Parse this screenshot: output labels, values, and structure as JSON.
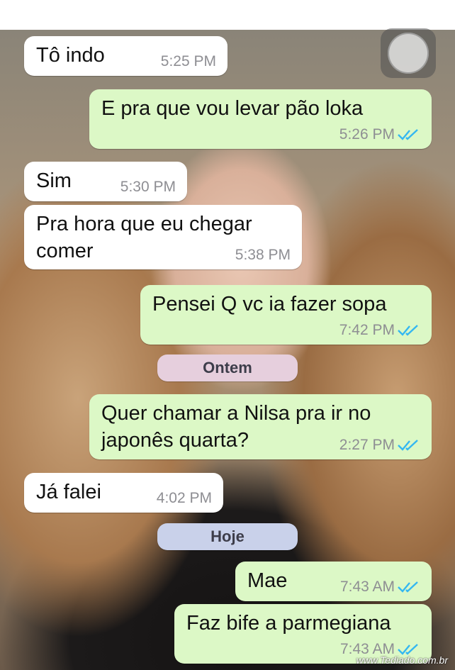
{
  "colors": {
    "incoming_bubble": "#ffffff",
    "outgoing_bubble": "#dcf8c6",
    "read_ticks": "#34b7f1",
    "pill_yesterday": "#e6cfdd",
    "pill_today": "#c9d1ea"
  },
  "messages": [
    {
      "text": "Tô indo",
      "time": "5:25 PM"
    },
    {
      "text": "E pra que vou levar pão loka",
      "time": "5:26 PM"
    },
    {
      "text": "Sim",
      "time": "5:30 PM"
    },
    {
      "text": "Pra hora que eu chegar\ncomer",
      "time": "5:38 PM"
    },
    {
      "text": "Pensei Q vc ia fazer sopa",
      "time": "7:42 PM"
    },
    {
      "text": "Quer chamar a Nilsa pra ir no\njaponês quarta?",
      "time": "2:27 PM"
    },
    {
      "text": "Já falei",
      "time": "4:02 PM"
    },
    {
      "text": "Mae",
      "time": "7:43 AM"
    },
    {
      "text": "Faz bife a parmegiana",
      "time": "7:43 AM"
    }
  ],
  "date_dividers": {
    "yesterday": "Ontem",
    "today": "Hoje"
  },
  "icons": {
    "read_receipt": "double-check-icon",
    "assistive_touch": "home-button-icon"
  },
  "watermark": "www.Tediado.com.br"
}
